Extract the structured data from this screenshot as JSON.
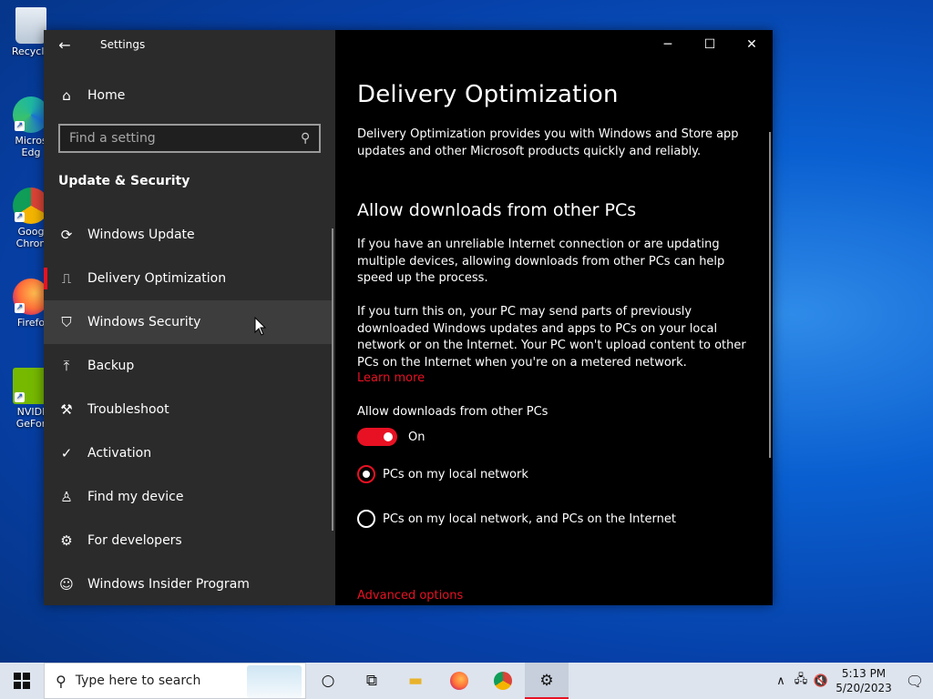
{
  "desktop": {
    "icons": [
      {
        "label": "Recycle",
        "name": "recycle-bin"
      },
      {
        "label": "Micros Edg",
        "name": "edge"
      },
      {
        "label": "Goog Chron",
        "name": "chrome"
      },
      {
        "label": "Firefo",
        "name": "firefox"
      },
      {
        "label": "NVIDI GeFor",
        "name": "nvidia"
      }
    ]
  },
  "window": {
    "title": "Settings",
    "controls": {
      "minimize": "─",
      "maximize": "☐",
      "close": "✕"
    }
  },
  "sidebar": {
    "home_label": "Home",
    "search_placeholder": "Find a setting",
    "section_title": "Update & Security",
    "items": [
      {
        "label": "Windows Update",
        "icon": "refresh-icon"
      },
      {
        "label": "Delivery Optimization",
        "icon": "delivery-icon"
      },
      {
        "label": "Windows Security",
        "icon": "shield-icon"
      },
      {
        "label": "Backup",
        "icon": "backup-icon"
      },
      {
        "label": "Troubleshoot",
        "icon": "wrench-icon"
      },
      {
        "label": "Activation",
        "icon": "check-circle-icon"
      },
      {
        "label": "Find my device",
        "icon": "person-icon"
      },
      {
        "label": "For developers",
        "icon": "dev-icon"
      },
      {
        "label": "Windows Insider Program",
        "icon": "insider-icon"
      }
    ]
  },
  "content": {
    "title": "Delivery Optimization",
    "intro": "Delivery Optimization provides you with Windows and Store app updates and other Microsoft products quickly and reliably.",
    "section_heading": "Allow downloads from other PCs",
    "para1": "If you have an unreliable Internet connection or are updating multiple devices, allowing downloads from other PCs can help speed up the process.",
    "para2": "If you turn this on, your PC may send parts of previously downloaded Windows updates and apps to PCs on your local network or on the Internet. Your PC won't upload content to other PCs on the Internet when you're on a metered network.",
    "learn_more": "Learn more",
    "toggle_label": "Allow downloads from other PCs",
    "toggle_state": "On",
    "radio_local": "PCs on my local network",
    "radio_internet": "PCs on my local network, and PCs on the Internet",
    "advanced_options": "Advanced options"
  },
  "taskbar": {
    "search_placeholder": "Type here to search",
    "time": "5:13 PM",
    "date": "5/20/2023"
  },
  "colors": {
    "accent": "#e81123",
    "sidebar_bg": "#2b2b2b",
    "content_bg": "#000000"
  }
}
